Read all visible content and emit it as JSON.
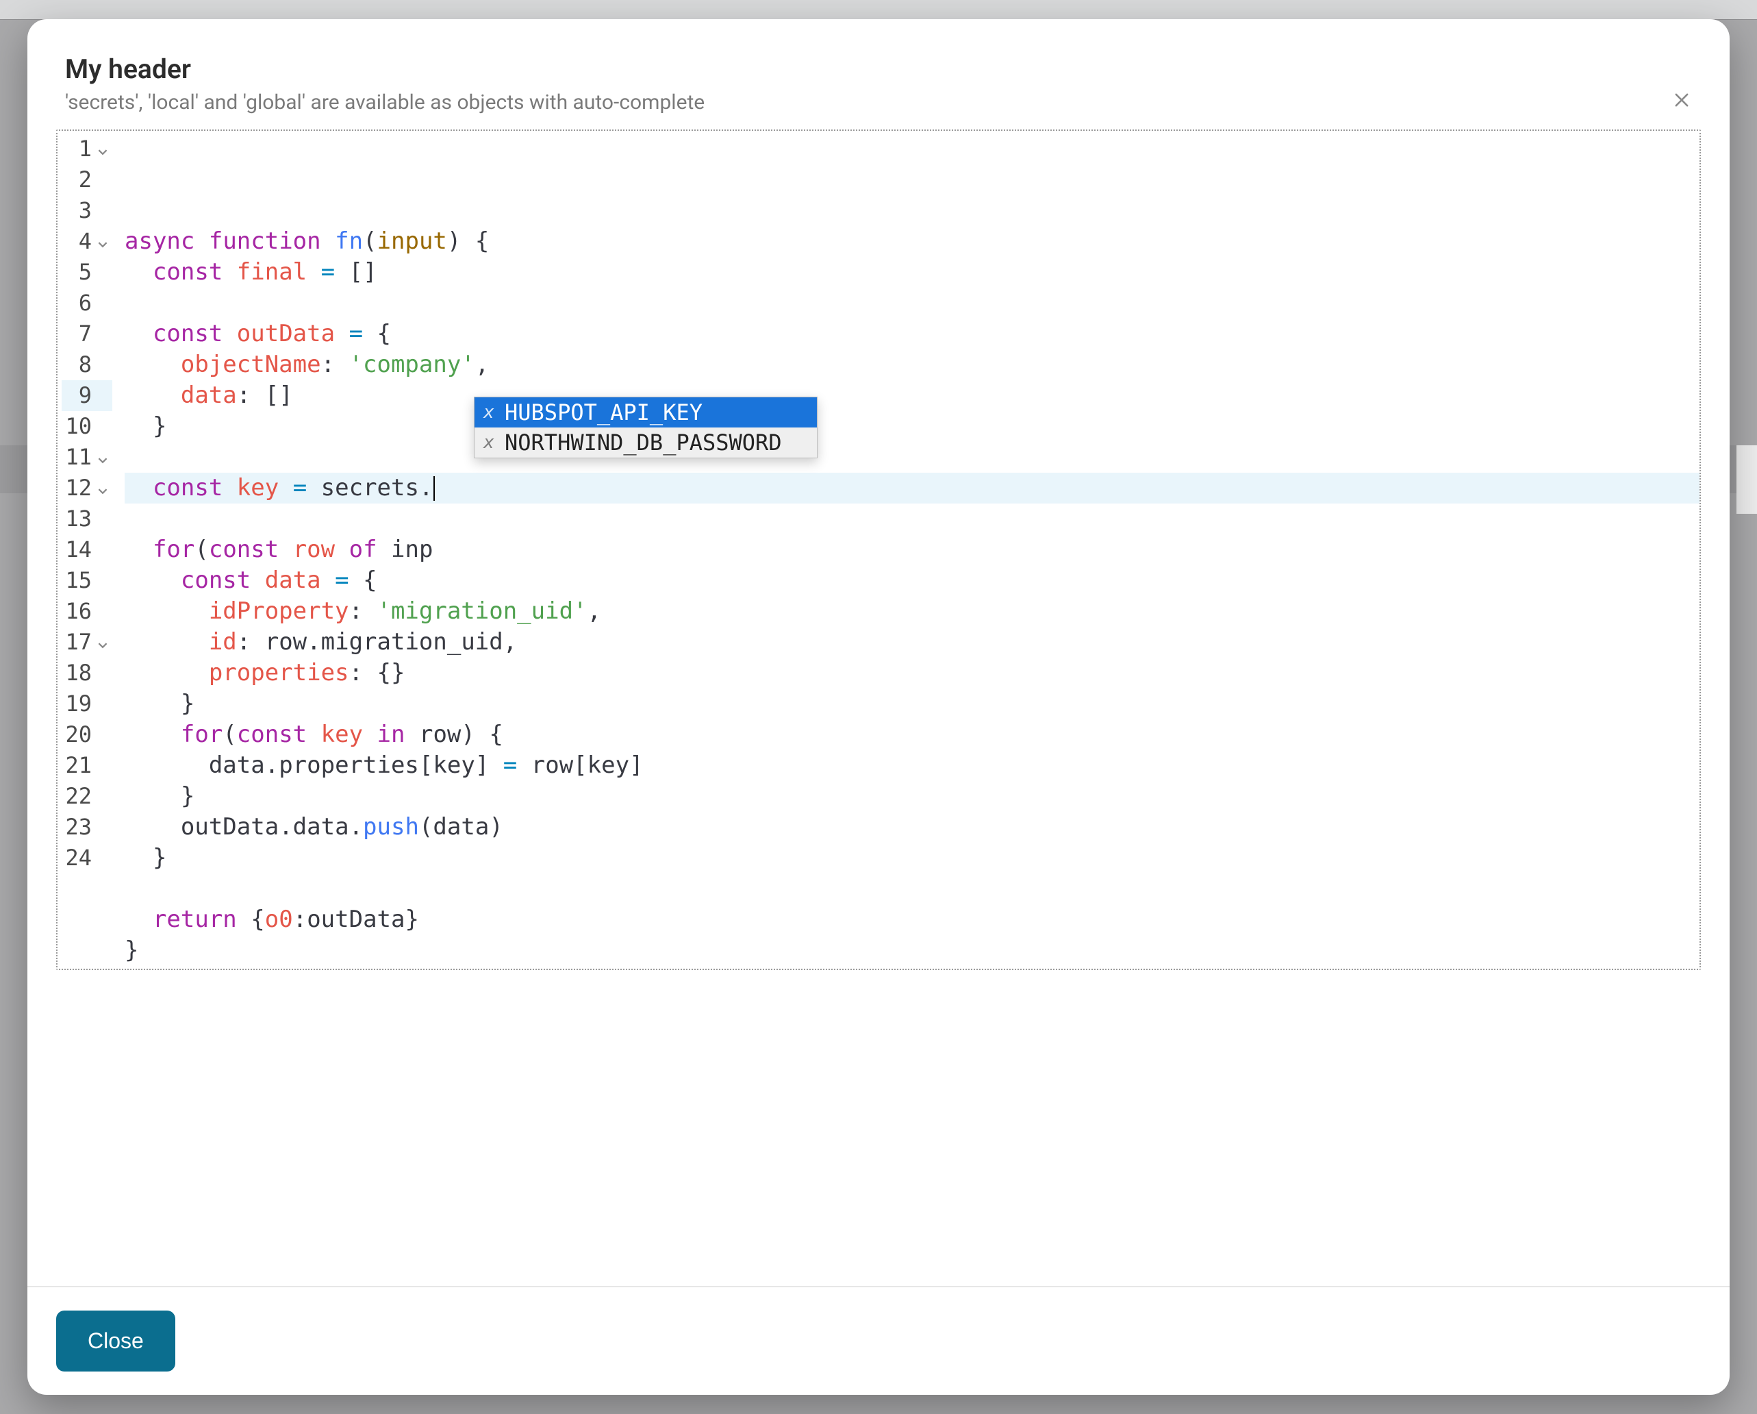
{
  "modal": {
    "title": "My header",
    "subtitle": "'secrets', 'local' and 'global' are available as objects with auto-complete",
    "closeLabel": "Close"
  },
  "autocomplete": {
    "items": [
      {
        "type": "x",
        "label": "HUBSPOT_API_KEY",
        "selected": true
      },
      {
        "type": "x",
        "label": "NORTHWIND_DB_PASSWORD",
        "selected": false
      }
    ]
  },
  "editor": {
    "highlightLine": 9,
    "lines": [
      {
        "n": 1,
        "fold": true,
        "tokens": [
          [
            "kw",
            "async"
          ],
          [
            "pun",
            " "
          ],
          [
            "kw",
            "function"
          ],
          [
            "pun",
            " "
          ],
          [
            "fn",
            "fn"
          ],
          [
            "pun",
            "("
          ],
          [
            "prm",
            "input"
          ],
          [
            "pun",
            ")"
          ],
          [
            "pun",
            " "
          ],
          [
            "pun",
            "{"
          ]
        ]
      },
      {
        "n": 2,
        "fold": false,
        "tokens": [
          [
            "pun",
            "  "
          ],
          [
            "kw",
            "const"
          ],
          [
            "pun",
            " "
          ],
          [
            "id2",
            "final"
          ],
          [
            "pun",
            " "
          ],
          [
            "op",
            "="
          ],
          [
            "pun",
            " "
          ],
          [
            "pun",
            "[]"
          ]
        ]
      },
      {
        "n": 3,
        "fold": false,
        "tokens": []
      },
      {
        "n": 4,
        "fold": true,
        "tokens": [
          [
            "pun",
            "  "
          ],
          [
            "kw",
            "const"
          ],
          [
            "pun",
            " "
          ],
          [
            "id2",
            "outData"
          ],
          [
            "pun",
            " "
          ],
          [
            "op",
            "="
          ],
          [
            "pun",
            " "
          ],
          [
            "pun",
            "{"
          ]
        ]
      },
      {
        "n": 5,
        "fold": false,
        "tokens": [
          [
            "pun",
            "    "
          ],
          [
            "propkey",
            "objectName"
          ],
          [
            "pun",
            ": "
          ],
          [
            "str",
            "'company'"
          ],
          [
            "pun",
            ","
          ]
        ]
      },
      {
        "n": 6,
        "fold": false,
        "tokens": [
          [
            "pun",
            "    "
          ],
          [
            "propkey",
            "data"
          ],
          [
            "pun",
            ": "
          ],
          [
            "pun",
            "[]"
          ]
        ]
      },
      {
        "n": 7,
        "fold": false,
        "tokens": [
          [
            "pun",
            "  "
          ],
          [
            "pun",
            "}"
          ]
        ]
      },
      {
        "n": 8,
        "fold": false,
        "tokens": []
      },
      {
        "n": 9,
        "fold": false,
        "tokens": [
          [
            "pun",
            "  "
          ],
          [
            "kw",
            "const"
          ],
          [
            "pun",
            " "
          ],
          [
            "id2",
            "key"
          ],
          [
            "pun",
            " "
          ],
          [
            "op",
            "="
          ],
          [
            "pun",
            " "
          ],
          [
            "ident",
            "secrets"
          ],
          [
            "pun",
            "."
          ]
        ],
        "cursor": true
      },
      {
        "n": 10,
        "fold": false,
        "tokens": []
      },
      {
        "n": 11,
        "fold": true,
        "tokens": [
          [
            "pun",
            "  "
          ],
          [
            "kw",
            "for"
          ],
          [
            "pun",
            "("
          ],
          [
            "kw",
            "const"
          ],
          [
            "pun",
            " "
          ],
          [
            "id2",
            "row"
          ],
          [
            "pun",
            " "
          ],
          [
            "kw",
            "of"
          ],
          [
            "pun",
            " "
          ],
          [
            "ident",
            "inp"
          ]
        ]
      },
      {
        "n": 12,
        "fold": true,
        "tokens": [
          [
            "pun",
            "    "
          ],
          [
            "kw",
            "const"
          ],
          [
            "pun",
            " "
          ],
          [
            "id2",
            "data"
          ],
          [
            "pun",
            " "
          ],
          [
            "op",
            "="
          ],
          [
            "pun",
            " "
          ],
          [
            "pun",
            "{"
          ]
        ]
      },
      {
        "n": 13,
        "fold": false,
        "tokens": [
          [
            "pun",
            "      "
          ],
          [
            "propkey",
            "idProperty"
          ],
          [
            "pun",
            ": "
          ],
          [
            "str",
            "'migration_uid'"
          ],
          [
            "pun",
            ","
          ]
        ]
      },
      {
        "n": 14,
        "fold": false,
        "tokens": [
          [
            "pun",
            "      "
          ],
          [
            "propkey",
            "id"
          ],
          [
            "pun",
            ": "
          ],
          [
            "ident",
            "row"
          ],
          [
            "pun",
            "."
          ],
          [
            "ident",
            "migration_uid"
          ],
          [
            "pun",
            ","
          ]
        ]
      },
      {
        "n": 15,
        "fold": false,
        "tokens": [
          [
            "pun",
            "      "
          ],
          [
            "propkey",
            "properties"
          ],
          [
            "pun",
            ": "
          ],
          [
            "pun",
            "{}"
          ]
        ]
      },
      {
        "n": 16,
        "fold": false,
        "tokens": [
          [
            "pun",
            "    "
          ],
          [
            "pun",
            "}"
          ]
        ]
      },
      {
        "n": 17,
        "fold": true,
        "tokens": [
          [
            "pun",
            "    "
          ],
          [
            "kw",
            "for"
          ],
          [
            "pun",
            "("
          ],
          [
            "kw",
            "const"
          ],
          [
            "pun",
            " "
          ],
          [
            "id2",
            "key"
          ],
          [
            "pun",
            " "
          ],
          [
            "kw",
            "in"
          ],
          [
            "pun",
            " "
          ],
          [
            "ident",
            "row"
          ],
          [
            "pun",
            ")"
          ],
          [
            "pun",
            " "
          ],
          [
            "pun",
            "{"
          ]
        ]
      },
      {
        "n": 18,
        "fold": false,
        "tokens": [
          [
            "pun",
            "      "
          ],
          [
            "ident",
            "data"
          ],
          [
            "pun",
            "."
          ],
          [
            "ident",
            "properties"
          ],
          [
            "pun",
            "["
          ],
          [
            "ident",
            "key"
          ],
          [
            "pun",
            "]"
          ],
          [
            "pun",
            " "
          ],
          [
            "op",
            "="
          ],
          [
            "pun",
            " "
          ],
          [
            "ident",
            "row"
          ],
          [
            "pun",
            "["
          ],
          [
            "ident",
            "key"
          ],
          [
            "pun",
            "]"
          ]
        ]
      },
      {
        "n": 19,
        "fold": false,
        "tokens": [
          [
            "pun",
            "    "
          ],
          [
            "pun",
            "}"
          ]
        ]
      },
      {
        "n": 20,
        "fold": false,
        "tokens": [
          [
            "pun",
            "    "
          ],
          [
            "ident",
            "outData"
          ],
          [
            "pun",
            "."
          ],
          [
            "ident",
            "data"
          ],
          [
            "pun",
            "."
          ],
          [
            "fn",
            "push"
          ],
          [
            "pun",
            "("
          ],
          [
            "ident",
            "data"
          ],
          [
            "pun",
            ")"
          ]
        ]
      },
      {
        "n": 21,
        "fold": false,
        "tokens": [
          [
            "pun",
            "  "
          ],
          [
            "pun",
            "}"
          ]
        ]
      },
      {
        "n": 22,
        "fold": false,
        "tokens": []
      },
      {
        "n": 23,
        "fold": false,
        "tokens": [
          [
            "pun",
            "  "
          ],
          [
            "kw",
            "return"
          ],
          [
            "pun",
            " "
          ],
          [
            "pun",
            "{"
          ],
          [
            "propkey",
            "o0"
          ],
          [
            "pun",
            ":"
          ],
          [
            "ident",
            "outData"
          ],
          [
            "pun",
            "}"
          ]
        ]
      },
      {
        "n": 24,
        "fold": false,
        "tokens": [
          [
            "pun",
            "}"
          ]
        ]
      }
    ]
  }
}
